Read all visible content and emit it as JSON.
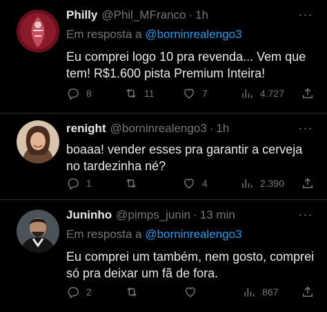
{
  "tweets": [
    {
      "name": "Philly",
      "handle": "@Phil_MFranco",
      "separator": "·",
      "time": "1h",
      "reply_prefix": "Em resposta a",
      "reply_mention": "@borninrealengo3",
      "text": "Eu comprei logo 10 pra revenda... Vem que tem! R$1.600 pista Premium Inteira!",
      "replies": "8",
      "retweets": "11",
      "likes": "7",
      "views": "4.727",
      "avatar_colors": [
        "#8a1a2a",
        "#c44d5e"
      ]
    },
    {
      "name": "renight",
      "handle": "@borninrealengo3",
      "separator": "·",
      "time": "1h",
      "text": "boaaa! vender esses pra garantir a cerveja no tardezinha né?",
      "replies": "1",
      "retweets": "",
      "likes": "4",
      "views": "2.390",
      "avatar_colors": [
        "#c9a27a",
        "#5a3a2a"
      ]
    },
    {
      "name": "Juninho",
      "handle": "@pimps_junin",
      "separator": "·",
      "time": "13 min",
      "reply_prefix": "Em resposta a",
      "reply_mention": "@borninrealengo3",
      "text": "Eu comprei um também, nem gosto, comprei só pra deixar um fã de fora.",
      "replies": "2",
      "retweets": "",
      "likes": "",
      "views": "867",
      "avatar_colors": [
        "#3a3f44",
        "#1a1a1a"
      ]
    }
  ],
  "icons": {
    "reply": "reply-icon",
    "retweet": "retweet-icon",
    "like": "heart-icon",
    "views": "views-icon",
    "share": "share-icon",
    "more": "more-icon"
  },
  "colors": {
    "background": "#000000",
    "text": "#e7e9ea",
    "muted": "#71767b",
    "link": "#1d9bf0",
    "divider": "#2f3336"
  }
}
